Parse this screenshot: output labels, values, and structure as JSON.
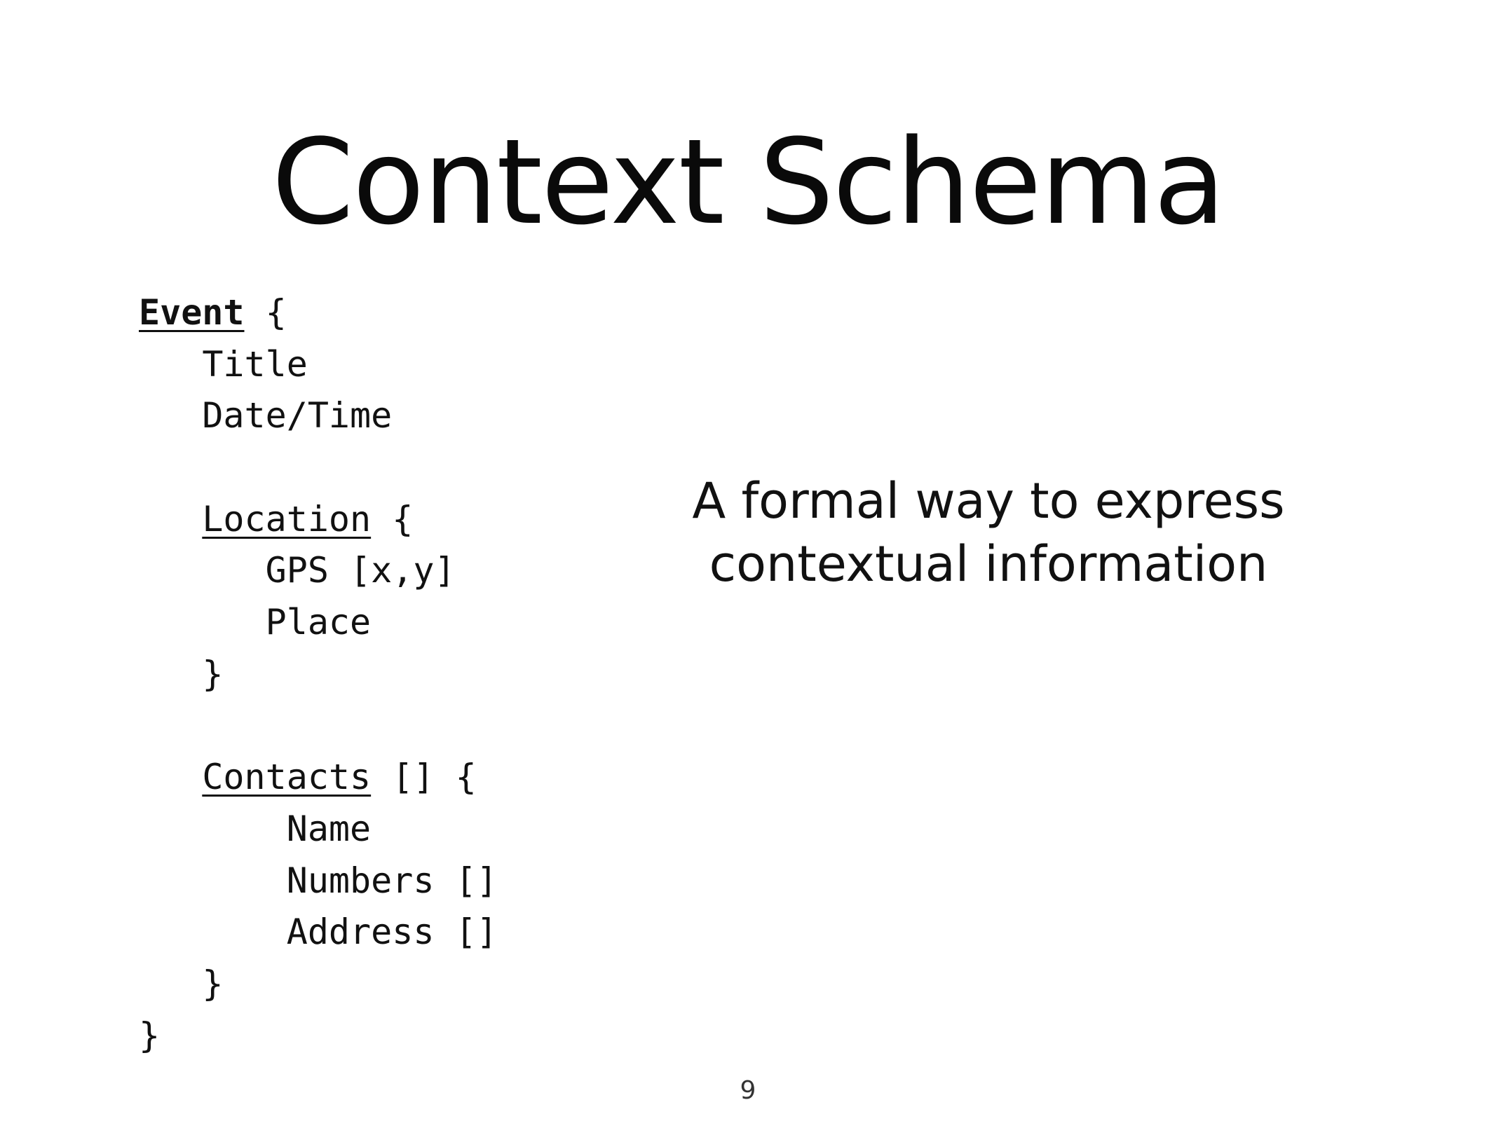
{
  "slide": {
    "title": "Context Schema",
    "description_lines": [
      "A formal way to express",
      "contextual information"
    ],
    "page_number": "9"
  },
  "schema": {
    "event_name": "Event",
    "open_brace": "{",
    "close_brace": "}",
    "event_fields": [
      "Title",
      "Date/Time"
    ],
    "location": {
      "name": "Location",
      "fields": [
        "GPS [x,y]",
        "Place"
      ]
    },
    "contacts": {
      "name": "Contacts",
      "suffix": "[]",
      "fields": [
        "Name",
        "Numbers []",
        "Address []"
      ]
    }
  }
}
